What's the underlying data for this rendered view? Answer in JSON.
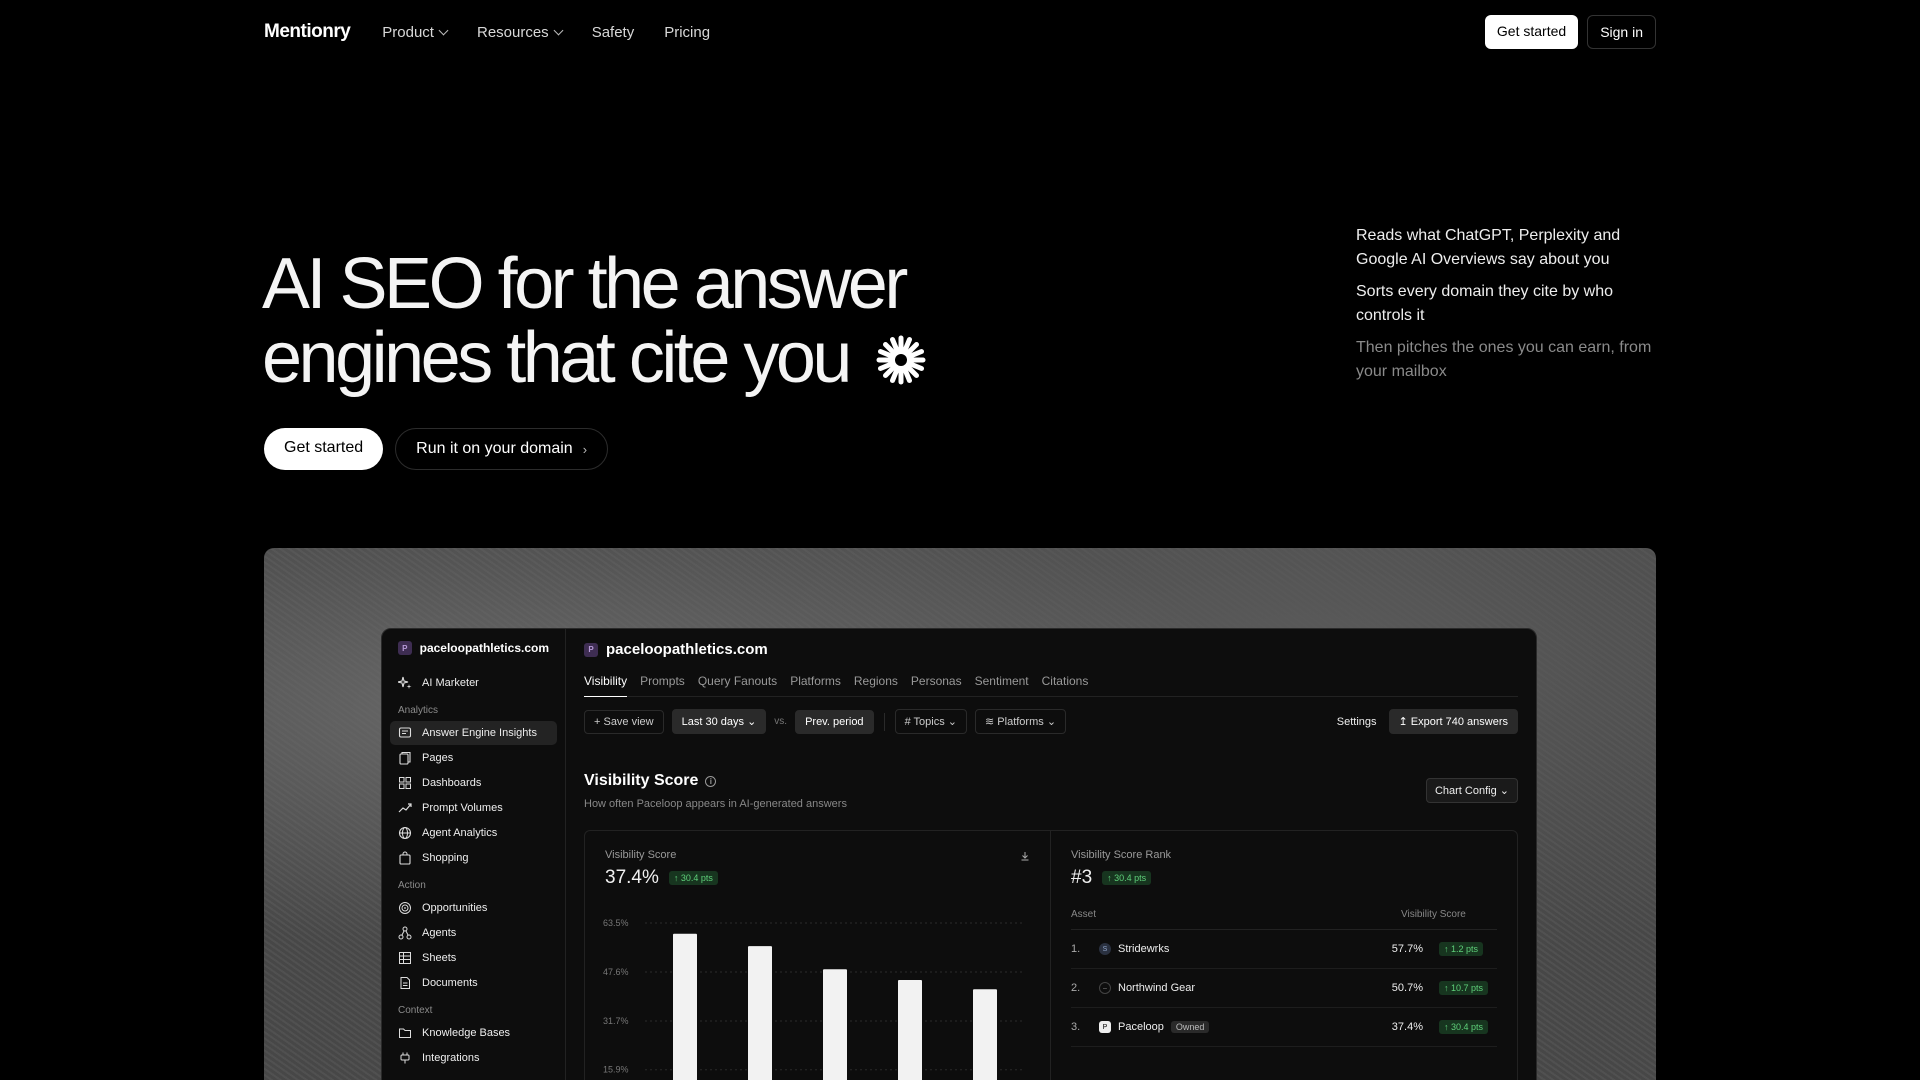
{
  "nav": {
    "logo": "Mentionry",
    "items": [
      {
        "label": "Product",
        "dropdown": true
      },
      {
        "label": "Resources",
        "dropdown": true
      },
      {
        "label": "Safety",
        "dropdown": false
      },
      {
        "label": "Pricing",
        "dropdown": false
      }
    ],
    "get_started": "Get started",
    "sign_in": "Sign in"
  },
  "hero": {
    "title_line1": "AI SEO for the answer",
    "title_line2": "engines that cite you",
    "cta_primary": "Get started",
    "cta_secondary": "Run it on your domain",
    "bullets": [
      "Reads what ChatGPT, Perplexity and Google AI Overviews say about you",
      "Sorts every domain they cite by who controls it",
      "Then pitches the ones you can earn, from your mailbox"
    ]
  },
  "app": {
    "domain": "paceloopathletics.com",
    "favicon_letter": "P",
    "sidebar": {
      "top": "AI Marketer",
      "sections": [
        {
          "title": "Analytics",
          "items": [
            "Answer Engine Insights",
            "Pages",
            "Dashboards",
            "Prompt Volumes",
            "Agent Analytics",
            "Shopping"
          ]
        },
        {
          "title": "Action",
          "items": [
            "Opportunities",
            "Agents",
            "Sheets",
            "Documents"
          ]
        },
        {
          "title": "Context",
          "items": [
            "Knowledge Bases",
            "Integrations"
          ]
        }
      ],
      "active_item": "Answer Engine Insights"
    },
    "tabs": [
      "Visibility",
      "Prompts",
      "Query Fanouts",
      "Platforms",
      "Regions",
      "Personas",
      "Sentiment",
      "Citations"
    ],
    "active_tab": "Visibility",
    "filters": {
      "save_view": "+ Save view",
      "range": "Last 30 days",
      "vs": "vs.",
      "compare": "Prev. period",
      "topics": "Topics",
      "platforms": "Platforms",
      "settings": "Settings",
      "export": "Export 740 answers"
    },
    "section": {
      "title": "Visibility Score",
      "subtitle": "How often Paceloop appears in AI-generated answers",
      "chart_config": "Chart Config"
    },
    "left_panel": {
      "label": "Visibility Score",
      "value": "37.4%",
      "delta": "↑ 30.4 pts"
    },
    "right_panel": {
      "label": "Visibility Score Rank",
      "value": "#3",
      "delta": "↑ 30.4 pts",
      "col_asset": "Asset",
      "col_score": "Visibility Score",
      "rows": [
        {
          "rank": "1.",
          "name": "Stridewrks",
          "icon": "S",
          "owned": "",
          "score": "57.7%",
          "delta": "↑ 1.2 pts"
        },
        {
          "rank": "2.",
          "name": "Northwind Gear",
          "icon": "–",
          "owned": "",
          "score": "50.7%",
          "delta": "↑ 10.7 pts"
        },
        {
          "rank": "3.",
          "name": "Paceloop",
          "icon": "P",
          "owned": "Owned",
          "score": "37.4%",
          "delta": "↑ 30.4 pts"
        }
      ]
    }
  },
  "chart_data": {
    "type": "bar",
    "categories": [
      "",
      "",
      "",
      "",
      ""
    ],
    "values": [
      60,
      56,
      48.5,
      45,
      42
    ],
    "ytick_labels": [
      "63.5%",
      "47.6%",
      "31.7%",
      "15.9%"
    ],
    "yticks": [
      63.5,
      47.6,
      31.7,
      15.9
    ],
    "ylim": [
      0,
      63.5
    ],
    "grid": true,
    "bar_color": "#f2f2f2"
  },
  "colors": {
    "background": "#000000",
    "positive": "#5fd07a",
    "favicon": "#3e2d52"
  }
}
